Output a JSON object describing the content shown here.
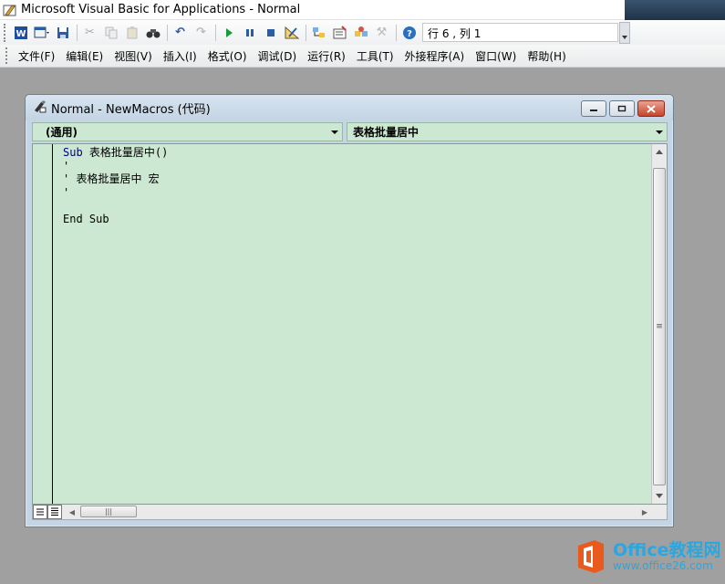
{
  "app": {
    "title": "Microsoft Visual Basic for Applications - Normal"
  },
  "toolbar": {
    "status": "行 6 , 列 1",
    "icons": [
      "word-icon",
      "insert-userform-icon",
      "save-icon",
      "cut-icon",
      "copy-icon",
      "paste-icon",
      "find-icon",
      "undo-icon",
      "redo-icon",
      "run-icon",
      "break-icon",
      "reset-icon",
      "design-mode-icon",
      "project-explorer-icon",
      "properties-icon",
      "object-browser-icon",
      "toolbox-icon",
      "help-icon"
    ]
  },
  "menu": {
    "items": [
      "文件(F)",
      "编辑(E)",
      "视图(V)",
      "插入(I)",
      "格式(O)",
      "调试(D)",
      "运行(R)",
      "工具(T)",
      "外接程序(A)",
      "窗口(W)",
      "帮助(H)"
    ]
  },
  "code_window": {
    "title": "Normal - NewMacros (代码)",
    "object_combo": "(通用)",
    "procedure_combo": "表格批量居中",
    "lines": {
      "l1_kw": "Sub",
      "l1_rest": " 表格批量居中()",
      "l2": "'",
      "l3": "' 表格批量居中 宏",
      "l4": "'",
      "l5": "",
      "l6": "End Sub"
    }
  },
  "colors": {
    "code_background": "#cde8d2",
    "keyword": "#000080",
    "comment": "#008000"
  },
  "watermark": {
    "brand": "Office教程网",
    "url": "www.office26.com"
  }
}
